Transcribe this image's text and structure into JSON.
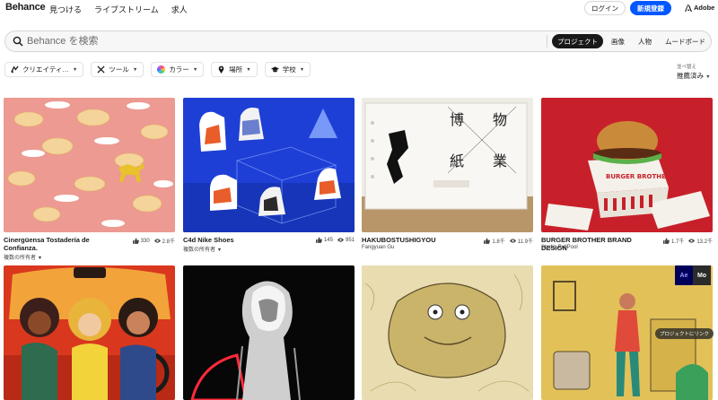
{
  "header": {
    "logo": "Behance",
    "nav": [
      "見つける",
      "ライブストリーム",
      "求人"
    ],
    "login": "ログイン",
    "signup": "新規登録",
    "adobe": "Adobe"
  },
  "search": {
    "placeholder": "Behance を検索",
    "tabs": [
      "プロジェクト",
      "画像",
      "人物",
      "ムードボード"
    ],
    "active_tab": "プロジェクト"
  },
  "filters": [
    {
      "label": "クリエイティ…",
      "icon": "creative-fields-icon"
    },
    {
      "label": "ツール",
      "icon": "tools-icon"
    },
    {
      "label": "カラー",
      "icon": "color-wheel-icon"
    },
    {
      "label": "場所",
      "icon": "location-pin-icon"
    },
    {
      "label": "学校",
      "icon": "school-cap-icon"
    }
  ],
  "sort": {
    "label": "並べ替え",
    "value": "推薦済み"
  },
  "projects": [
    {
      "title": "Cinergüensa Tostadería de Confianza.",
      "owner": "複数の所有者",
      "owner_dropdown": true,
      "likes": "330",
      "views": "2.8千"
    },
    {
      "title": "C4d Nike Shoes",
      "owner": "複数の所有者",
      "owner_dropdown": true,
      "likes": "145",
      "views": "951"
    },
    {
      "title": "HAKUBOSTUSHIGYOU",
      "owner": "Fangyuan Gu",
      "owner_dropdown": false,
      "likes": "1.8千",
      "views": "11.9千"
    },
    {
      "title": "BURGER BROTHER BRAND DESIGN",
      "owner": "Studio PullPool",
      "owner_dropdown": false,
      "likes": "1.7千",
      "views": "13.2千"
    }
  ],
  "overlay": {
    "ae": "Ae",
    "mo": "Mo",
    "project_link": "プロジェクトにリンク"
  },
  "thumb_text": {
    "hakubo_chars": [
      "博",
      "物",
      "紙",
      "業"
    ],
    "burger_box": "BURGER BROTHER"
  },
  "colors": {
    "accent": "#0057ff",
    "text": "#191919"
  }
}
